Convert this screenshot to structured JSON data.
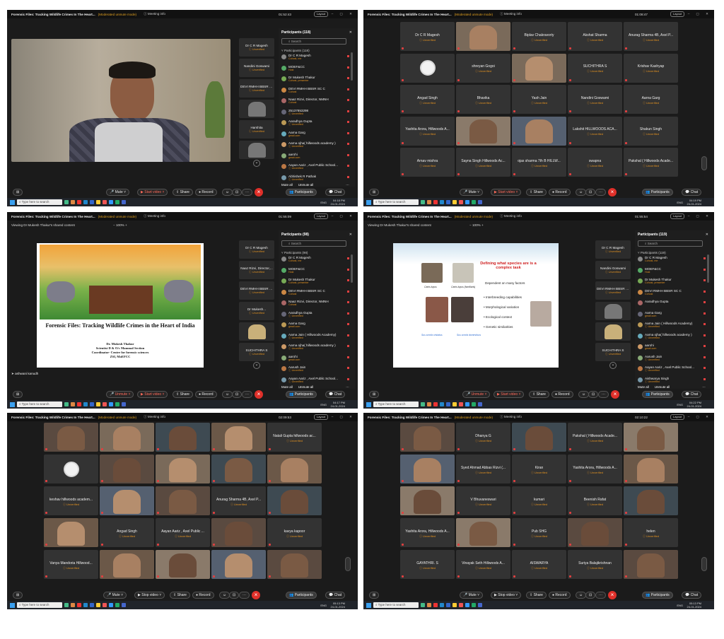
{
  "meeting": {
    "title": "Forensic Files: Tracking Wildlife Crimes In The Heart...",
    "warning": "(Moderated unmute mode)",
    "info": "Meeting info",
    "layout": "Layout",
    "unverified": "Unverified",
    "end_symbol": "×"
  },
  "taskbar": {
    "search": "Type here to search",
    "lang": "ENG",
    "date": "24-01-2024"
  },
  "controls": {
    "mute": "Mute",
    "unmute": "Unmute",
    "start_video": "Start video",
    "stop_video": "Stop video",
    "share": "Share",
    "record": "Record",
    "participants": "Participants",
    "chat": "Chat"
  },
  "panel": {
    "search": "Search",
    "mute_all": "Mute all",
    "unmute_all": "Unmute all"
  },
  "shots": [
    {
      "time": "01:52:43",
      "clock": "04:18 PM",
      "panel_title": "Participants (118)",
      "panel_head": "Participants (118)",
      "participants": [
        {
          "name": "Dr C R Magesh",
          "sub": "Cohost, me"
        },
        {
          "name": "MOEF&CC",
          "sub": "Host"
        },
        {
          "name": "Dr Mukesh Thakur",
          "sub": "Cohost, presenter"
        },
        {
          "name": "DEVI RMHH BBSR SC C",
          "sub": "Cohost"
        },
        {
          "name": "Naaz Rizvi, Director, NMNH",
          "sub": "Cohost"
        },
        {
          "name": "25137853298",
          "sub": ""
        },
        {
          "name": "Aaradhya Gupta",
          "sub": ""
        },
        {
          "name": "Aarna Garg",
          "sub": "gmail.com"
        },
        {
          "name": "Aarna ojha( hillwoods academy )",
          "sub": ""
        },
        {
          "name": "aarohi",
          "sub": "gmail.com"
        },
        {
          "name": "Aayan Aariz , Axel Public School...",
          "sub": ""
        },
        {
          "name": "Abhishek R Pathak",
          "sub": ""
        }
      ],
      "side": [
        {
          "name": "Dr C R Magesh"
        },
        {
          "name": "Nandini Goswami"
        },
        {
          "name": "DEVI RMHH BBSR SC C"
        },
        {
          "name": ""
        },
        {
          "name": "Harshita"
        },
        {
          "name": ""
        }
      ]
    },
    {
      "time": "01:08:47",
      "clock": "04:19 PM",
      "tiles": [
        "Dr C R Magesh",
        "",
        "Biplav Chakravorty",
        "Akshat Sharma",
        "Anurag Sharma 4B, Axel P...",
        "",
        "shreyan Gogoi",
        "",
        "SUCHITHRA S",
        "Krishav Kashyap",
        "Angad Singh",
        "Bhavika",
        "Yash Jain",
        "Nandini Goswami",
        "Aarna Garg",
        "Yashita Arora, Hillwoods A...",
        "",
        "",
        "Lakshit HILLWOODS ACA...",
        "Shakun Singh",
        "Arnav mishra",
        "Sayna Singh Hillwoods Ac...",
        "ojas sharma 7th B HILLW...",
        "swapna",
        "Pakshal ( Hillwoods Acade..."
      ]
    },
    {
      "time": "01:55:09",
      "clock": "04:17 PM",
      "share_label": "Viewing Dr Mukesh Thakur's shared content",
      "zoom": "100%",
      "slide_title": "Forensic Files: Tracking Wildlife Crimes in the Heart of India",
      "slide_lines": [
        "Dr. Mukesh Thakur",
        "Scientist D & O/c Mammal Section",
        "Coordinator- Centre for forensic sciences",
        "ZSI, MoEFCC"
      ],
      "speaker": "ashwani kanudh",
      "panel_title": "Participants (98)",
      "panel_head": "Participants (98)",
      "participants": [
        {
          "name": "Dr C R Magesh",
          "sub": "Cohost, me"
        },
        {
          "name": "MOEF&CC",
          "sub": "Host"
        },
        {
          "name": "Dr Mukesh Thakur",
          "sub": "Cohost, presenter"
        },
        {
          "name": "DEVI RMHH BBSR SC C",
          "sub": "Cohost"
        },
        {
          "name": "Naaz Rizvi, Director, NMNH",
          "sub": "Cohost"
        },
        {
          "name": "Aaradhya Gupta",
          "sub": ""
        },
        {
          "name": "Aarna Garg",
          "sub": "gmail.com"
        },
        {
          "name": "Aarna Jain ( Hillwoods Academy)",
          "sub": ""
        },
        {
          "name": "Aarna ojha( hillwoods academy )",
          "sub": ""
        },
        {
          "name": "aarohi",
          "sub": "gmail.com"
        },
        {
          "name": "Aarush Jain",
          "sub": ""
        },
        {
          "name": "Aayan Aariz , Axel Public School...",
          "sub": ""
        }
      ],
      "side": [
        {
          "name": "Dr C R Magesh"
        },
        {
          "name": "Naaz Rizvi, Director,..."
        },
        {
          "name": "DEVI RMHH BBSR SC C"
        },
        {
          "name": "Dr Mukesh..."
        },
        {
          "name": ""
        },
        {
          "name": "SUCHITHRA S"
        }
      ]
    },
    {
      "time": "01:55:54",
      "clock": "04:22 PM",
      "share_label": "Viewing Dr Mukesh Thakur's shared content",
      "zoom": "100%",
      "slide_heading": "Defining what species are is a complex task",
      "slide_sub": "Dependent on many factors",
      "bullets": [
        "Interbreeding capabilities",
        "Morphological variation",
        "Ecological context",
        "Genetic similarities"
      ],
      "captions": [
        "Canis lupus",
        "Canis lupus (familiaris)",
        "Sus scrofa cristatus",
        "Sus scrofa domesticus"
      ],
      "panel_title": "Participants (119)",
      "panel_head": "Participants (119)",
      "participants": [
        {
          "name": "Dr C R Magesh",
          "sub": "Cohost, me"
        },
        {
          "name": "MOEF&CC",
          "sub": "Host"
        },
        {
          "name": "Dr Mukesh Thakur",
          "sub": "Cohost, presenter"
        },
        {
          "name": "DEVI RMHH BBSR SC C",
          "sub": "Cohost"
        },
        {
          "name": "Aaradhya Gupta",
          "sub": ""
        },
        {
          "name": "Aarna Garg",
          "sub": "gmail.com"
        },
        {
          "name": "Aarna Jain ( Hillwoods Academy)",
          "sub": ""
        },
        {
          "name": "Aarna ojha( hillwoods academy )",
          "sub": ""
        },
        {
          "name": "aarohi",
          "sub": "gmail.com"
        },
        {
          "name": "Aarush Jain",
          "sub": ""
        },
        {
          "name": "Aayan Aariz , Axel Public School...",
          "sub": ""
        },
        {
          "name": "Aishwarya Singh",
          "sub": ""
        }
      ],
      "side": [
        {
          "name": "Dr C R Magesh"
        },
        {
          "name": "Nandini Goswami"
        },
        {
          "name": "DEVI RMHH BBSR SC C"
        },
        {
          "name": ""
        },
        {
          "name": ""
        },
        {
          "name": "SUCHITHRA S"
        }
      ]
    },
    {
      "time": "02:09:53",
      "clock": "05:13 PM",
      "tiles": [
        "",
        "",
        "",
        "",
        "Natali Gupta hillwoods ac...",
        "",
        "",
        "",
        "",
        "",
        "keshav hillwoods academ...",
        "",
        "",
        "Anurag Sharma 4B, Axel P...",
        "",
        "",
        "Angad Singh",
        "Aayan Aariz , Axel Public ...",
        "",
        "kavya kapoor",
        "Vanya Mandoria Hillwood...",
        "",
        "",
        "",
        ""
      ]
    },
    {
      "time": "02:10:22",
      "clock": "05:13 PM",
      "tiles": [
        "",
        "Dhanya G",
        "",
        "Pakshal ( Hillwoods Acade...",
        "",
        "",
        "Syed Ahmad Abbas Rizvi (...",
        "Kiran",
        "Yashita Arora, Hillwoods A...",
        "",
        "",
        "V Bhuvaneswari",
        "kumari",
        "Beenish Rafat",
        "",
        "Yashita Arora, Hillwoods A...",
        "",
        "Pub SHG",
        "",
        "helen",
        "GAYATHRI. S",
        "Vinayak Seth Hillwoods A...",
        "AISWARYA",
        "Suriya Balajikrishnan",
        "",
        "Srishti Seth Hillwood 6A"
      ]
    }
  ]
}
